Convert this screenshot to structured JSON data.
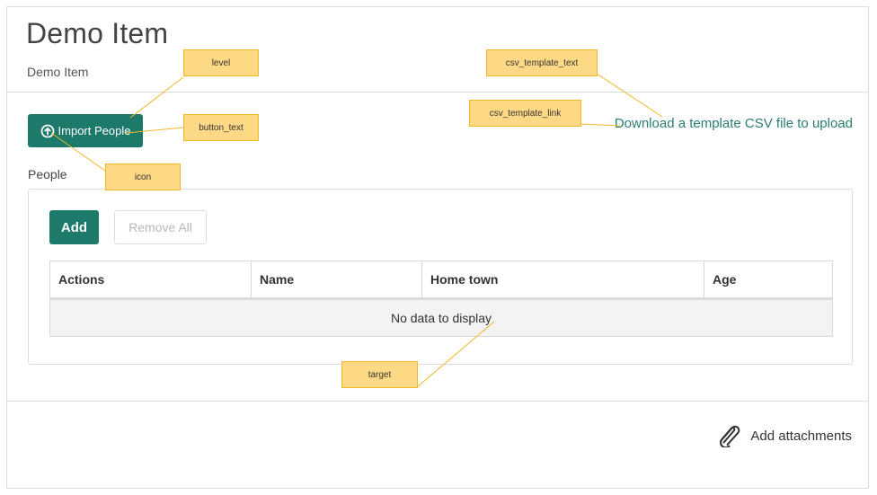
{
  "header": {
    "title": "Demo Item",
    "subtitle": "Demo Item"
  },
  "actions": {
    "import_button_label": "Import People",
    "csv_template_link": "Download a template CSV file to upload"
  },
  "people": {
    "section_label": "People",
    "add_label": "Add",
    "remove_all_label": "Remove All",
    "columns": [
      "Actions",
      "Name",
      "Home town",
      "Age"
    ],
    "empty_message": "No data to display"
  },
  "footer": {
    "attach_label": "Add attachments"
  },
  "annotations": {
    "level": "level",
    "button_text": "button_text",
    "icon": "icon",
    "csv_template_text": "csv_template_text",
    "csv_template_link": "csv_template_link",
    "target": "target"
  },
  "icons": {
    "import": "arrow-up-circle-icon",
    "attach": "paperclip-icon"
  },
  "colors": {
    "primary": "#1d7a6b",
    "link": "#2a7d74",
    "annotation_fill": "#fdd985",
    "annotation_line": "#f1b728"
  }
}
